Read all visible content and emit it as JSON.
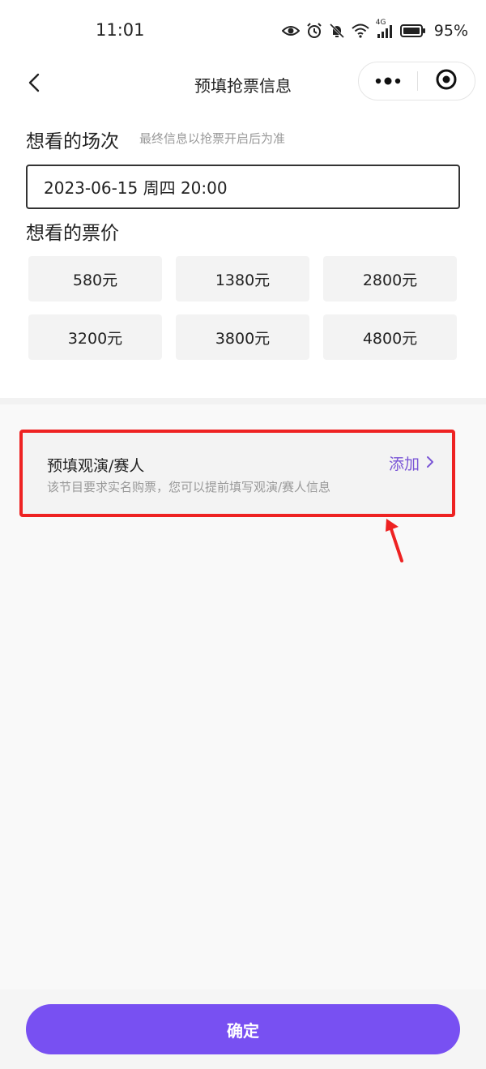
{
  "status_bar": {
    "time": "11:01",
    "battery": "95%",
    "network_label": "4G",
    "icons": [
      "eye-icon",
      "alarm-icon",
      "mute-bell-icon",
      "wifi-icon",
      "signal-icon",
      "battery-icon"
    ]
  },
  "header": {
    "title": "预填抢票信息",
    "back_icon": "back-chevron-icon",
    "capsule_icons": [
      "more-dots-icon",
      "close-target-icon"
    ]
  },
  "session": {
    "title": "想看的场次",
    "hint": "最终信息以抢票开启后为准",
    "selected": "2023-06-15 周四 20:00"
  },
  "price": {
    "title": "想看的票价",
    "options": [
      "580元",
      "1380元",
      "2800元",
      "3200元",
      "3800元",
      "4800元"
    ]
  },
  "attendee": {
    "title": "预填观演/赛人",
    "description": "该节目要求实名购票，您可以提前填写观演/赛人信息",
    "action_label": "添加",
    "highlight_color": "#ee2222"
  },
  "footer": {
    "confirm_label": "确定",
    "accent_color": "#7850f2"
  }
}
